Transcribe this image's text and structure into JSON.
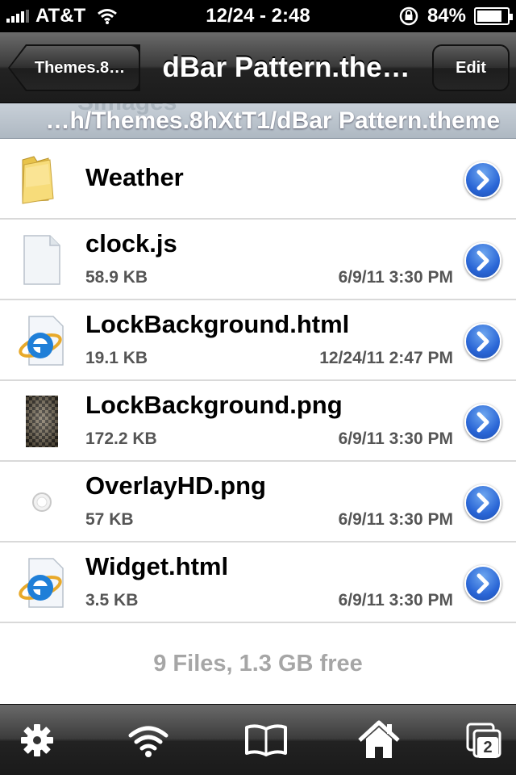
{
  "status_bar": {
    "carrier": "AT&T",
    "time": "12/24 - 2:48",
    "battery": "84%",
    "battery_level": 0.84
  },
  "nav": {
    "back_label": "Themes.8…",
    "title": "dBar Pattern.the…",
    "edit_label": "Edit"
  },
  "path": {
    "text": "…h/Themes.8hXtT1/dBar Pattern.theme",
    "ghost": "SImages"
  },
  "files": [
    {
      "name": "Weather",
      "size": "",
      "date": "",
      "icon": "folder-icon"
    },
    {
      "name": "clock.js",
      "size": "58.9 KB",
      "date": "6/9/11 3:30 PM",
      "icon": "document-icon"
    },
    {
      "name": "LockBackground.html",
      "size": "19.1 KB",
      "date": "12/24/11 2:47 PM",
      "icon": "html-icon"
    },
    {
      "name": "LockBackground.png",
      "size": "172.2 KB",
      "date": "6/9/11 3:30 PM",
      "icon": "image-thumbnail-icon"
    },
    {
      "name": "OverlayHD.png",
      "size": "57 KB",
      "date": "6/9/11 3:30 PM",
      "icon": "image-thumbnail-icon"
    },
    {
      "name": "Widget.html",
      "size": "3.5 KB",
      "date": "6/9/11 3:30 PM",
      "icon": "html-icon"
    }
  ],
  "footer": {
    "info": "9 Files, 1.3 GB free"
  },
  "toolbar": {
    "tabs_count": "2",
    "items": [
      "settings-gear-icon",
      "wifi-icon",
      "bookmarks-book-icon",
      "home-icon",
      "tabs-icon"
    ]
  }
}
